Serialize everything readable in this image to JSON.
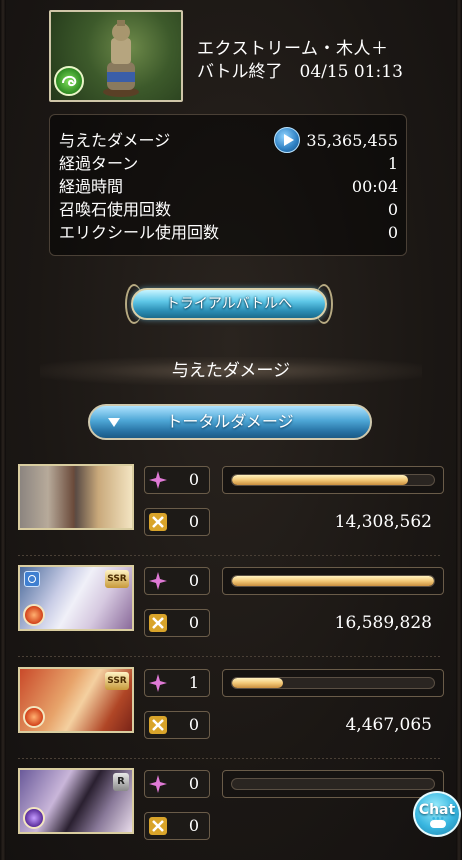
{
  "quest": {
    "title": "エクストリーム・木人＋",
    "battle_end": "バトル終了　04/15 01:13",
    "element_icon": "wind-element-icon"
  },
  "stats": {
    "rows": [
      {
        "label": "与えたダメージ",
        "value": "35,365,455"
      },
      {
        "label": "経過ターン",
        "value": "1"
      },
      {
        "label": "経過時間",
        "value": "00:04"
      },
      {
        "label": "召喚石使用回数",
        "value": "0"
      },
      {
        "label": "エリクシール使用回数",
        "value": "0"
      }
    ]
  },
  "trial_button": {
    "label": "トライアルバトルへ"
  },
  "section": {
    "title": "与えたダメージ"
  },
  "dropdown": {
    "label": "トータルダメージ"
  },
  "characters": [
    {
      "portrait": "main-character-and-djeeta-portrait",
      "element": "none",
      "rarity": "",
      "sp_count": "0",
      "ca_count": "0",
      "gauge_fraction": 0.87,
      "damage": "14,308,562"
    },
    {
      "portrait": "ssr-fire-character-portrait",
      "element": "fire",
      "rarity": "SSR",
      "sp_count": "0",
      "ca_count": "0",
      "gauge_fraction": 1.0,
      "damage": "16,589,828"
    },
    {
      "portrait": "ssr-fire-character-portrait-2",
      "element": "fire",
      "rarity": "SSR",
      "sp_count": "1",
      "ca_count": "0",
      "gauge_fraction": 0.25,
      "damage": "4,467,065"
    },
    {
      "portrait": "r-dark-character-portrait",
      "element": "dark",
      "rarity": "R",
      "sp_count": "0",
      "ca_count": "0",
      "gauge_fraction": 0.0,
      "damage": ""
    }
  ],
  "chat": {
    "label": "Chat"
  },
  "colors": {
    "accent_blue": "#4ea7d6",
    "gauge_gold": "#f3c978",
    "panel_border": "#4a4036"
  }
}
